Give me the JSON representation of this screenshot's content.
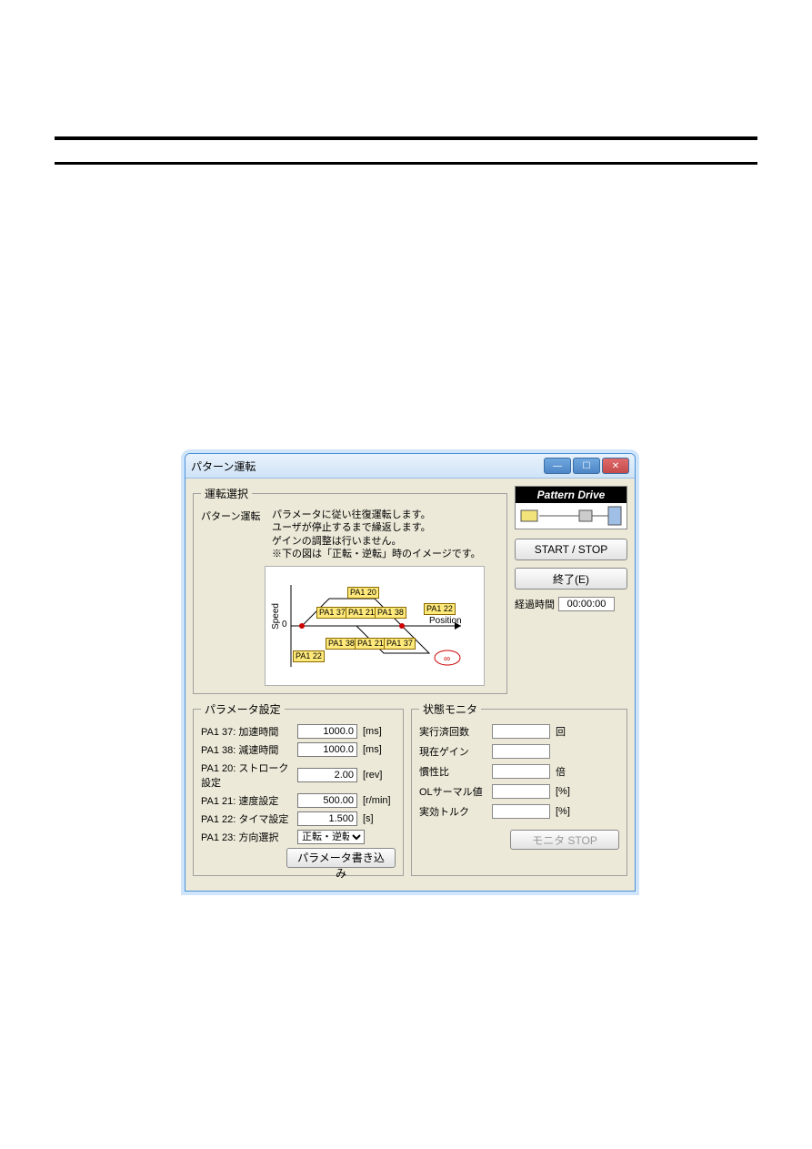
{
  "window": {
    "title": "パターン運転"
  },
  "selection": {
    "legend": "運転選択",
    "mode_label": "パターン運転",
    "desc1": "パラメータに従い往復運転します。",
    "desc2": "ユーザが停止するまで繰返します。",
    "desc3": "ゲインの調整は行いません。",
    "desc4": "※下の図は「正転・逆転」時のイメージです。"
  },
  "diagram": {
    "speed_label": "Speed",
    "position_label": "Position",
    "zero": "0",
    "pa1_20": "PA1\n20",
    "pa1_21": "PA1\n21",
    "pa1_22": "PA1\n22",
    "pa1_37": "PA1\n37",
    "pa1_38": "PA1\n38"
  },
  "brand": {
    "title": "Pattern Drive"
  },
  "buttons": {
    "start_stop": "START / STOP",
    "exit": "終了(E)",
    "write": "パラメータ書き込み",
    "monitor_stop": "モニタ STOP"
  },
  "elapsed": {
    "label": "経過時間",
    "value": "00:00:00"
  },
  "params": {
    "legend": "パラメータ設定",
    "rows": [
      {
        "label": "PA1 37: 加速時間",
        "value": "1000.0",
        "unit": "[ms]"
      },
      {
        "label": "PA1 38: 減速時間",
        "value": "1000.0",
        "unit": "[ms]"
      },
      {
        "label": "PA1 20: ストローク設定",
        "value": "2.00",
        "unit": "[rev]"
      },
      {
        "label": "PA1 21: 速度設定",
        "value": "500.00",
        "unit": "[r/min]"
      },
      {
        "label": "PA1 22: タイマ設定",
        "value": "1.500",
        "unit": "[s]"
      }
    ],
    "dir_label": "PA1 23: 方向選択",
    "dir_value": "正転・逆転"
  },
  "monitor": {
    "legend": "状態モニタ",
    "rows": [
      {
        "label": "実行済回数",
        "value": "",
        "unit": "回"
      },
      {
        "label": "現在ゲイン",
        "value": "",
        "unit": ""
      },
      {
        "label": "慣性比",
        "value": "",
        "unit": "倍"
      },
      {
        "label": "OLサーマル値",
        "value": "",
        "unit": "[%]"
      },
      {
        "label": "実効トルク",
        "value": "",
        "unit": "[%]"
      }
    ]
  }
}
